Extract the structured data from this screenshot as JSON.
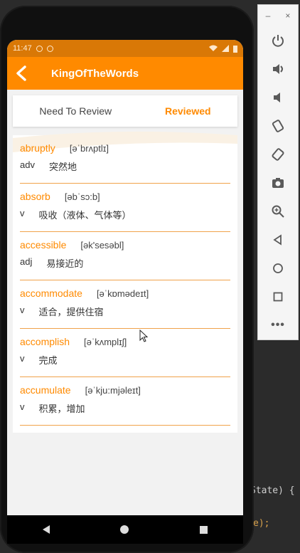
{
  "ide": {
    "code1": "State) {",
    "code2": "e);"
  },
  "status": {
    "time": "11:47"
  },
  "app": {
    "title": "KingOfTheWords"
  },
  "tabs": [
    {
      "label": "Need To Review",
      "active": false
    },
    {
      "label": "Reviewed",
      "active": true
    }
  ],
  "words": [
    {
      "word": "abruptly",
      "phonetic": "[əˈbrʌptlɪ]",
      "pos": "adv",
      "meaning": "突然地"
    },
    {
      "word": "absorb",
      "phonetic": "[əbˈsɔ:b]",
      "pos": "v",
      "meaning": "吸收（液体、气体等）"
    },
    {
      "word": "accessible",
      "phonetic": "[ək'sesəbl]",
      "pos": "adj",
      "meaning": "易接近的"
    },
    {
      "word": "accommodate",
      "phonetic": "[əˈkɒmədeɪt]",
      "pos": "v",
      "meaning": "适合，提供住宿"
    },
    {
      "word": "accomplish",
      "phonetic": "[əˈkʌmplɪʃ]",
      "pos": "v",
      "meaning": "完成"
    },
    {
      "word": "accumulate",
      "phonetic": "[əˈkju:mjəleɪt]",
      "pos": "v",
      "meaning": "积累，增加"
    }
  ],
  "panel": {
    "minimize": "–",
    "close": "×",
    "more": "•••"
  },
  "colors": {
    "accent": "#ff8a00",
    "statusbar": "#d97806"
  }
}
